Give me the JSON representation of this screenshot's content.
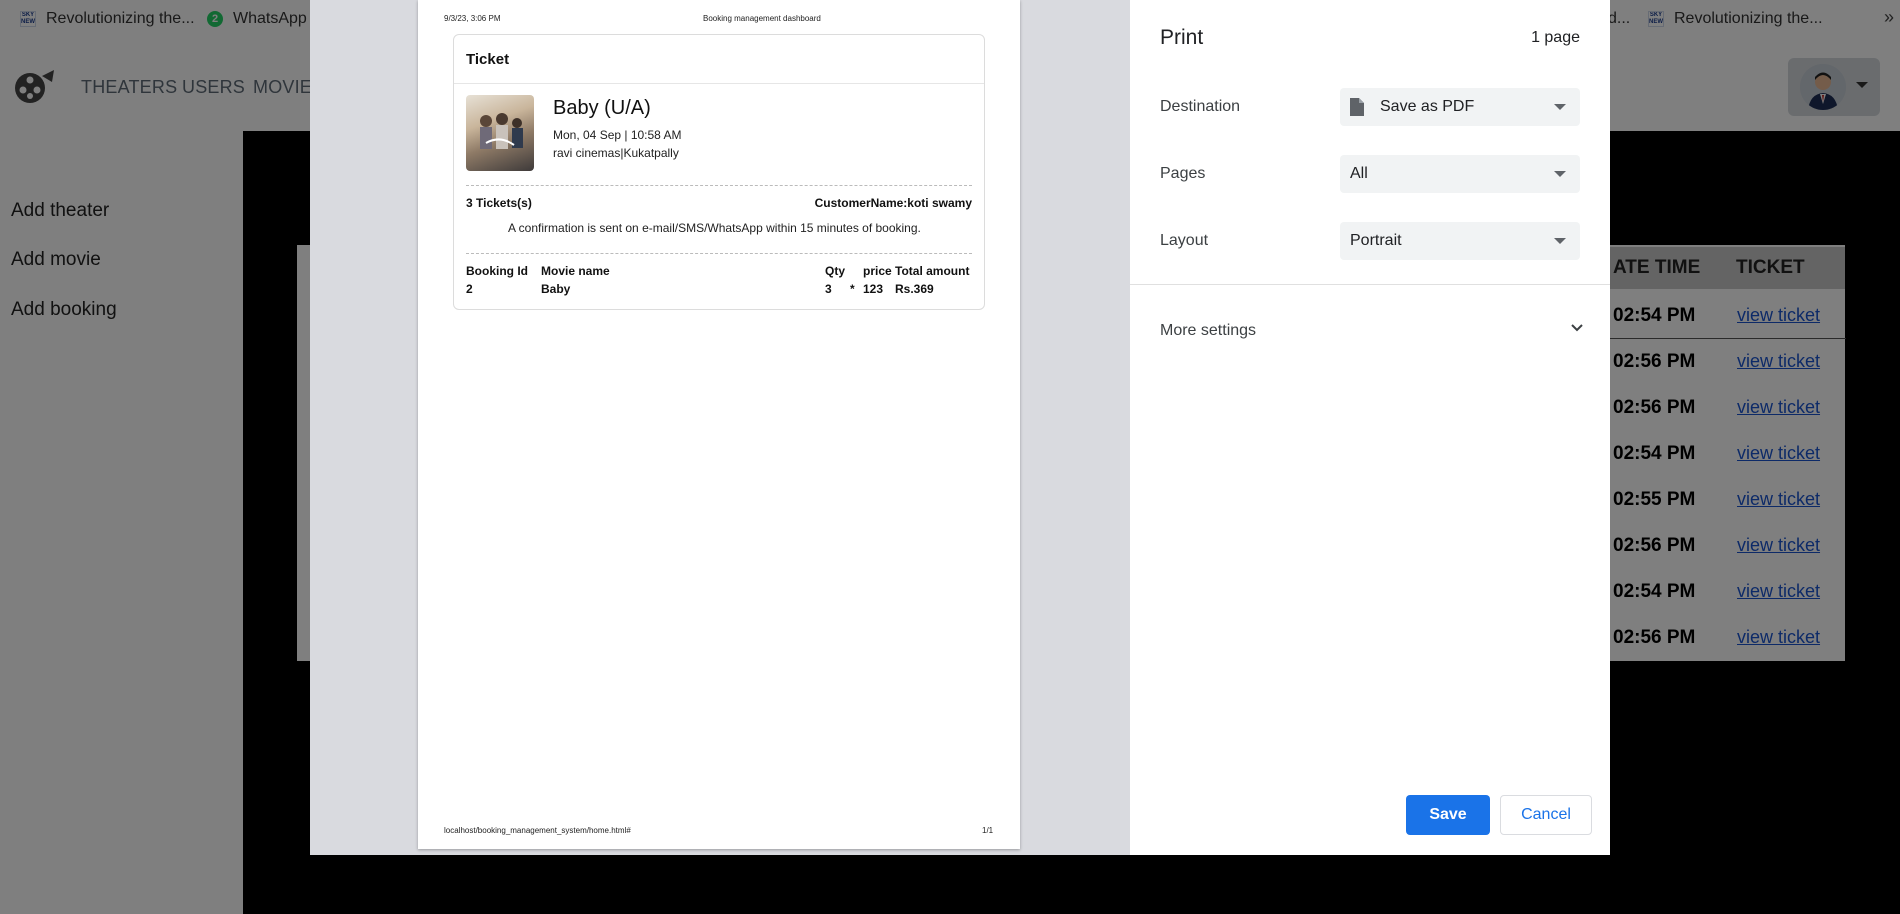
{
  "bookmarks": [
    {
      "label": "Revolutionizing the...",
      "icon": "sky-news-favicon"
    },
    {
      "label": "WhatsApp",
      "badge": "2",
      "icon": "whatsapp-favicon"
    },
    {
      "label": "d..."
    },
    {
      "label": "Revolutionizing the...",
      "icon": "sky-news-favicon"
    }
  ],
  "bookmarks_overflow": "»",
  "favicon_text": "SKY NEWS",
  "nav": {
    "theaters": "THEATERS",
    "users": "USERS",
    "movies": "MOVIE"
  },
  "sidebar": {
    "items": [
      "Add theater",
      "Add movie",
      "Add booking"
    ]
  },
  "table": {
    "headers": [
      "ATE TIME",
      "TICKET"
    ],
    "rows": [
      {
        "time": "02:54 PM",
        "link": "view ticket"
      },
      {
        "time": "02:56 PM",
        "link": "view ticket"
      },
      {
        "time": "02:56 PM",
        "link": "view ticket"
      },
      {
        "time": "02:54 PM",
        "link": "view ticket"
      },
      {
        "time": "02:55 PM",
        "link": "view ticket"
      },
      {
        "time": "02:56 PM",
        "link": "view ticket"
      },
      {
        "time": "02:54 PM",
        "link": "view ticket"
      },
      {
        "time": "02:56 PM",
        "link": "view ticket"
      }
    ]
  },
  "preview": {
    "header_date": "9/3/23, 3:06 PM",
    "header_title": "Booking management dashboard",
    "footer_url": "localhost/booking_management_system/home.html#",
    "footer_page": "1/1",
    "ticket": {
      "title": "Ticket",
      "movie": "Baby (U/A)",
      "datetime": "Mon, 04 Sep | 10:58 AM",
      "venue": "ravi cinemas|Kukatpally",
      "tickets_count": "3 Tickets(s)",
      "customer": "CustomerName:koti swamy",
      "confirmation": "A confirmation is sent on e-mail/SMS/WhatsApp within 15 minutes of booking.",
      "columns": {
        "booking_id": "Booking Id",
        "movie_name": "Movie name",
        "qty": "Qty",
        "price": "price",
        "total": "Total amount"
      },
      "row": {
        "booking_id": "2",
        "movie_name": "Baby",
        "qty": "3",
        "mult": "*",
        "price": "123",
        "total": "Rs.369"
      }
    }
  },
  "print": {
    "title": "Print",
    "page_count": "1 page",
    "destination_label": "Destination",
    "destination_value": "Save as PDF",
    "pages_label": "Pages",
    "pages_value": "All",
    "layout_label": "Layout",
    "layout_value": "Portrait",
    "more_settings": "More settings",
    "save": "Save",
    "cancel": "Cancel"
  },
  "colors": {
    "primary": "#1a73e8",
    "link": "#1a55d0",
    "table_header": "#c8c8c8"
  }
}
